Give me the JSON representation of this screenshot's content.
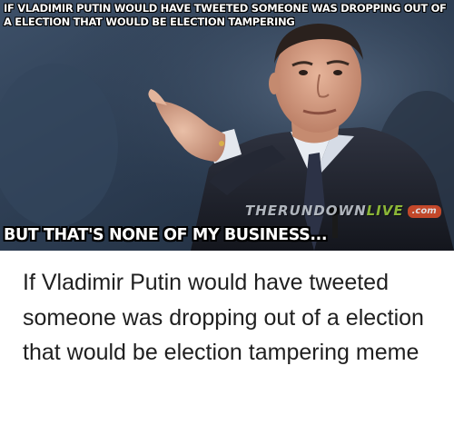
{
  "meme": {
    "top_caption": "IF VLADIMIR PUTIN WOULD HAVE TWEETED SOMEONE WAS DROPPING OUT OF A ELECTION THAT WOULD BE ELECTION TAMPERING",
    "bottom_caption": "BUT THAT'S NONE OF MY BUSINESS...",
    "watermark": {
      "main": "THERUNDOWN",
      "accent": "LIVE",
      "suffix": ".com"
    },
    "photo_description_icon": "man-pointing-photo"
  },
  "description": "If Vladimir Putin would have tweeted someone was dropping out of a election that would be election tampering meme",
  "colors": {
    "caption_text": "#ffffff",
    "caption_outline": "#000000",
    "description_text": "#1f1f1f",
    "watermark_accent": "#9fd13a"
  }
}
